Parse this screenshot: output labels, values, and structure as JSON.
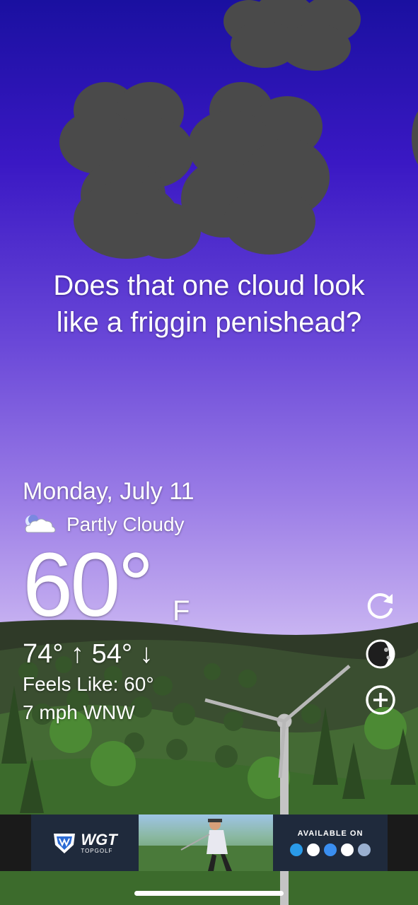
{
  "quip": {
    "line1": "Does that one cloud look",
    "line2": "like a friggin penishead?"
  },
  "weather": {
    "date": "Monday, July 11",
    "condition": "Partly Cloudy",
    "condition_icon": "partly-cloudy-night-icon",
    "temperature": "60°",
    "unit": "F",
    "high": "74°",
    "low": "54°",
    "feels_like": "Feels Like: 60°",
    "wind": "7 mph WNW"
  },
  "controls": [
    {
      "name": "refresh-icon"
    },
    {
      "name": "moon-phase-icon"
    },
    {
      "name": "add-location-icon"
    }
  ],
  "ad": {
    "brand": "WGT",
    "sub_brand": "TOPGOLF",
    "cta": "AVAILABLE ON"
  },
  "colors": {
    "sky_top": "#1a10a0",
    "sky_bottom": "#c8b4f2",
    "grass": "#3c6b2c",
    "cloud": "#4a4a4a"
  }
}
